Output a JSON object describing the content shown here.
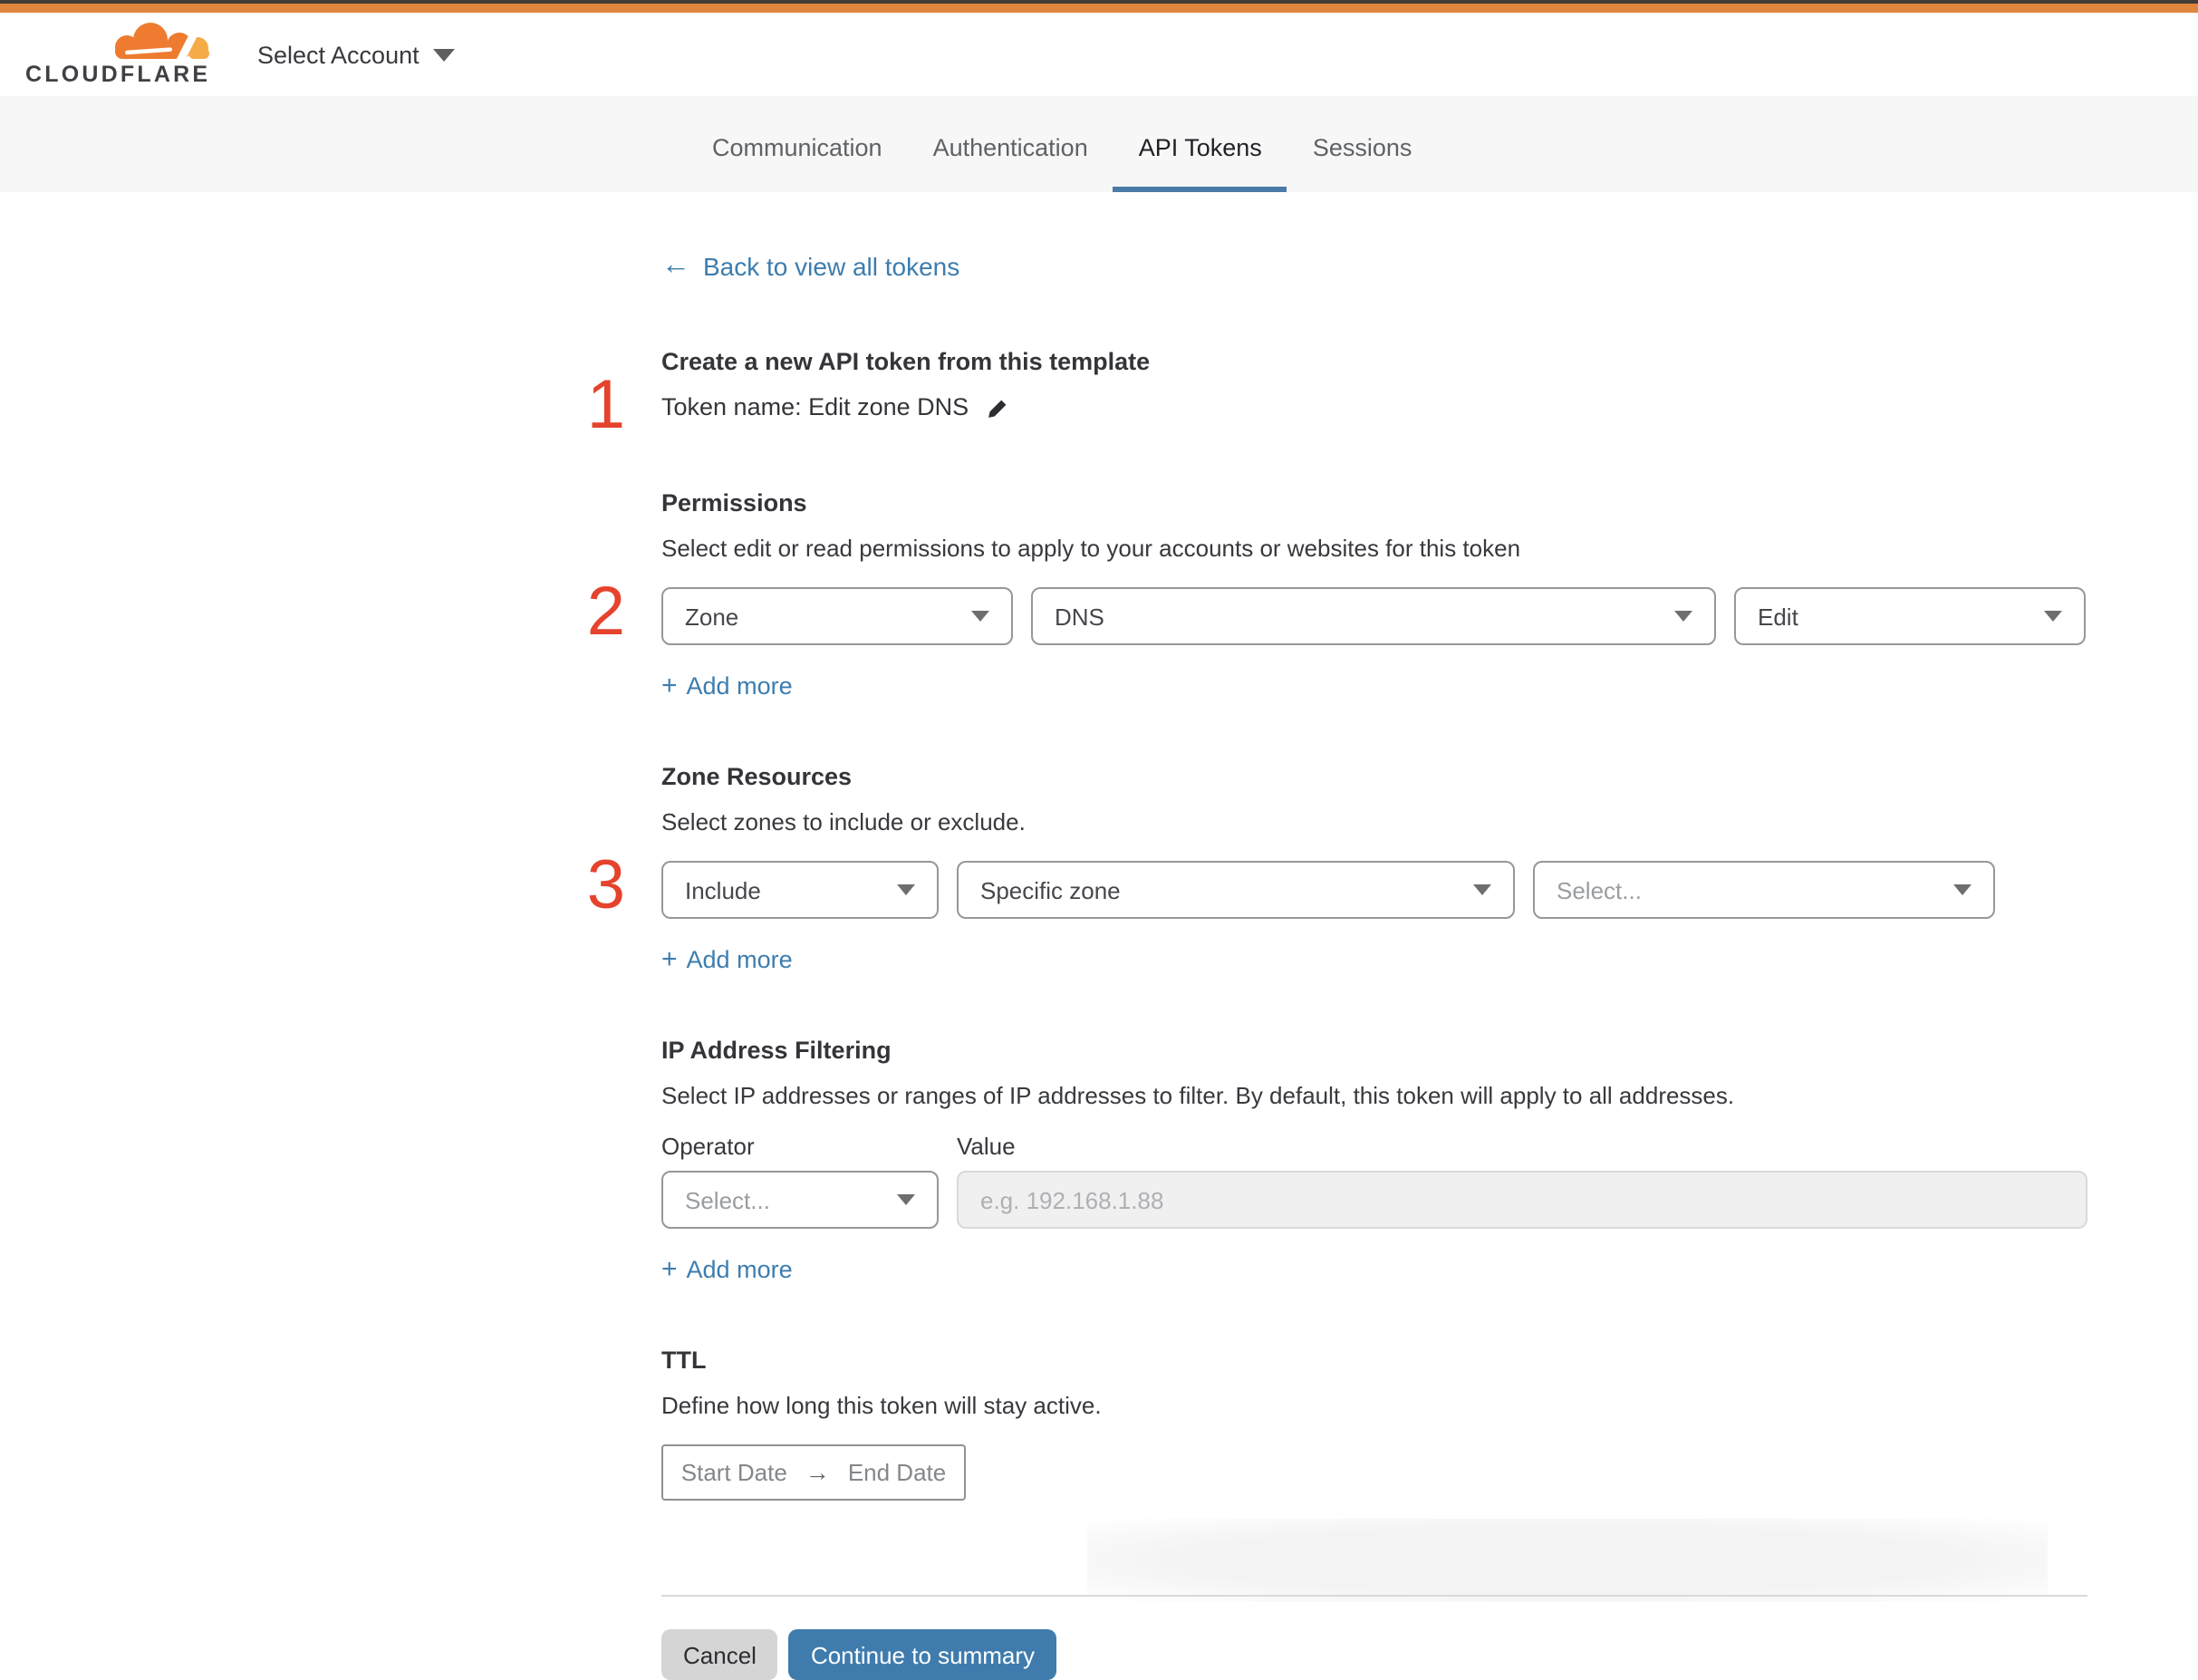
{
  "colors": {
    "brand_orange": "#e0873d",
    "link_blue": "#3d7dae",
    "tab_underline": "#4a7aa8",
    "primary_button": "#3f7cad",
    "step_red": "#e5432d"
  },
  "header": {
    "brand": "CLOUDFLARE",
    "account_selector": "Select Account"
  },
  "tabs": {
    "items": [
      {
        "label": "Communication"
      },
      {
        "label": "Authentication"
      },
      {
        "label": "API Tokens"
      },
      {
        "label": "Sessions"
      }
    ],
    "active": "API Tokens"
  },
  "back_link": {
    "arrow": "←",
    "label": "Back to view all tokens"
  },
  "token": {
    "step_number": "1",
    "heading": "Create a new API token from this template",
    "name_line": "Token name: Edit zone DNS"
  },
  "permissions": {
    "step_number": "2",
    "heading": "Permissions",
    "subtitle": "Select edit or read permissions to apply to your accounts or websites for this token",
    "scope_select": {
      "value": "Zone"
    },
    "resource_select": {
      "value": "DNS"
    },
    "access_select": {
      "value": "Edit"
    },
    "add_more": {
      "plus": "+",
      "label": "Add more"
    }
  },
  "zone_resources": {
    "step_number": "3",
    "heading": "Zone Resources",
    "subtitle": "Select zones to include or exclude.",
    "mode_select": {
      "value": "Include"
    },
    "type_select": {
      "value": "Specific zone"
    },
    "zone_select": {
      "placeholder": "Select..."
    },
    "add_more": {
      "plus": "+",
      "label": "Add more"
    }
  },
  "ip_filtering": {
    "heading": "IP Address Filtering",
    "subtitle": "Select IP addresses or ranges of IP addresses to filter. By default, this token will apply to all addresses.",
    "operator_label": "Operator",
    "value_label": "Value",
    "operator_select": {
      "placeholder": "Select..."
    },
    "value_input": {
      "placeholder": "e.g. 192.168.1.88",
      "value": ""
    },
    "add_more": {
      "plus": "+",
      "label": "Add more"
    }
  },
  "ttl": {
    "heading": "TTL",
    "subtitle": "Define how long this token will stay active.",
    "start_placeholder": "Start Date",
    "arrow": "→",
    "end_placeholder": "End Date"
  },
  "footer": {
    "cancel_label": "Cancel",
    "continue_label": "Continue to summary"
  }
}
